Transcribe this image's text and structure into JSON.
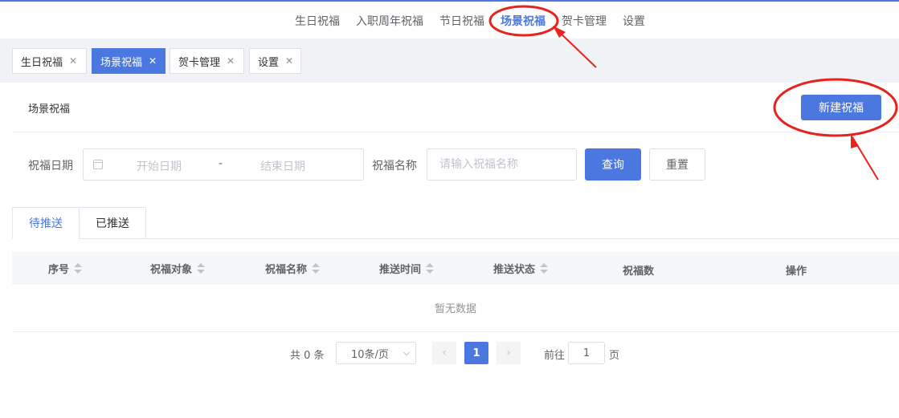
{
  "top_nav": {
    "items": [
      "生日祝福",
      "入职周年祝福",
      "节日祝福",
      "场景祝福",
      "贺卡管理",
      "设置"
    ],
    "active_index": 3
  },
  "tags": [
    {
      "label": "生日祝福"
    },
    {
      "label": "场景祝福"
    },
    {
      "label": "贺卡管理"
    },
    {
      "label": "设置"
    }
  ],
  "page": {
    "title": "场景祝福",
    "new_button": "新建祝福"
  },
  "filters": {
    "date_label": "祝福日期",
    "start_placeholder": "开始日期",
    "separator": "-",
    "end_placeholder": "结束日期",
    "name_label": "祝福名称",
    "name_placeholder": "请输入祝福名称",
    "query_button": "查询",
    "reset_button": "重置"
  },
  "tabs": [
    "待推送",
    "已推送"
  ],
  "table": {
    "columns": [
      "序号",
      "祝福对象",
      "祝福名称",
      "推送时间",
      "推送状态",
      "祝福数",
      "操作"
    ],
    "empty_text": "暂无数据"
  },
  "pagination": {
    "total_text": "共 0 条",
    "page_size": "10条/页",
    "prev": "‹",
    "current_page": "1",
    "next": "›",
    "goto_label": "前往",
    "goto_value": "1",
    "page_unit": "页"
  },
  "colors": {
    "primary": "#4a78e0",
    "annotation": "#e8231d"
  }
}
